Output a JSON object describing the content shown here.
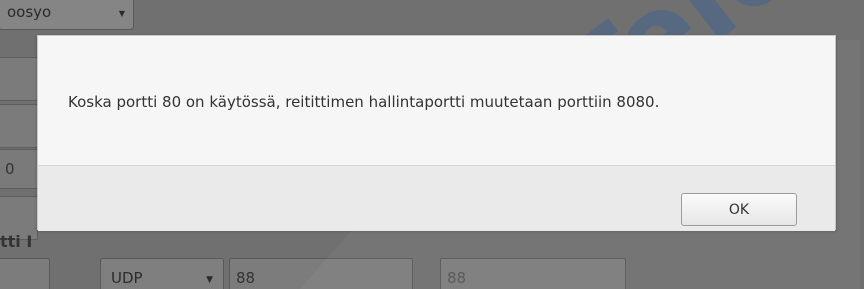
{
  "background": {
    "top_select_value": "oosyo",
    "left_field_value": "0",
    "section_label": "tti I",
    "row": {
      "field_1_value": "",
      "protocol_select_value": "UDP",
      "port_start_value": "88",
      "port_end_value": "88"
    }
  },
  "watermark": {
    "text": "Tele"
  },
  "dialog": {
    "message": "Koska portti 80 on käytössä, reitittimen hallintaportti muutetaan porttiin 8080.",
    "ok_label": "OK"
  },
  "colors": {
    "overlay": "#707070",
    "dialog_bg": "#f6f6f6",
    "watermark": "#1f5aa6"
  }
}
